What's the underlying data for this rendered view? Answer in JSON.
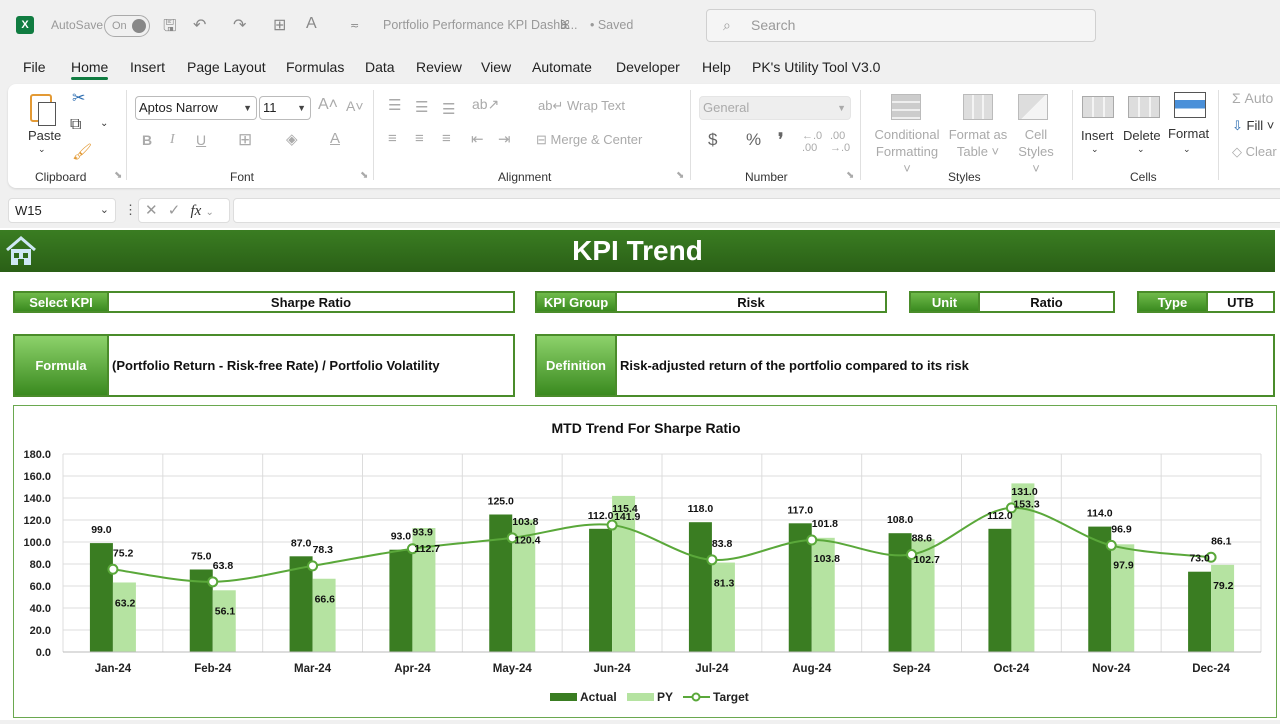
{
  "titlebar": {
    "app_icon": "excel-logo-icon",
    "app_letter": "X",
    "autosave_label": "AutoSave",
    "autosave_state": "On",
    "document_title": "Portfolio Performance KPI Dashb...",
    "saved_status": "• Saved",
    "search_placeholder": "Search"
  },
  "menu": {
    "items": [
      "File",
      "Home",
      "Insert",
      "Page Layout",
      "Formulas",
      "Data",
      "Review",
      "View",
      "Automate",
      "Developer",
      "Help",
      "PK's Utility Tool V3.0"
    ],
    "active": "Home"
  },
  "ribbon": {
    "clipboard": {
      "paste_label": "Paste",
      "group_label": "Clipboard"
    },
    "font": {
      "font_name": "Aptos Narrow",
      "font_size": "11",
      "bold": "B",
      "italic": "I",
      "underline": "U",
      "group_label": "Font"
    },
    "alignment": {
      "wrap_text": "Wrap Text",
      "merge_center": "Merge & Center",
      "group_label": "Alignment"
    },
    "number": {
      "format": "General",
      "currency": "$",
      "percent": "%",
      "comma": "❜",
      "group_label": "Number"
    },
    "styles": {
      "conditional_formatting": [
        "Conditional",
        "Formatting"
      ],
      "format_as_table": [
        "Format as",
        "Table"
      ],
      "cell_styles": [
        "Cell",
        "Styles"
      ],
      "group_label": "Styles"
    },
    "cells": {
      "insert": "Insert",
      "delete": "Delete",
      "format": "Format",
      "group_label": "Cells"
    },
    "editing": {
      "autosum": "Auto",
      "fill": "Fill",
      "clear": "Clear"
    }
  },
  "formula_bar": {
    "name_box": "W15",
    "fx": "fx",
    "formula": ""
  },
  "dashboard": {
    "title": "KPI Trend",
    "select_kpi": {
      "label": "Select KPI",
      "value": "Sharpe Ratio"
    },
    "kpi_group": {
      "label": "KPI Group",
      "value": "Risk"
    },
    "unit": {
      "label": "Unit",
      "value": "Ratio"
    },
    "type": {
      "label": "Type",
      "value": "UTB"
    },
    "formula": {
      "label": "Formula",
      "value": "(Portfolio Return - Risk-free Rate) / Portfolio Volatility"
    },
    "definition": {
      "label": "Definition",
      "value": "Risk-adjusted return of the portfolio compared to its risk"
    }
  },
  "colors": {
    "actual": "#3a7d22",
    "py": "#b5e3a1",
    "target": "#5aa83a",
    "banner": "#2f6b1a"
  },
  "chart_data": {
    "type": "bar",
    "title": "MTD Trend For Sharpe Ratio",
    "xlabel": "",
    "ylabel": "",
    "categories": [
      "Jan-24",
      "Feb-24",
      "Mar-24",
      "Apr-24",
      "May-24",
      "Jun-24",
      "Jul-24",
      "Aug-24",
      "Sep-24",
      "Oct-24",
      "Nov-24",
      "Dec-24"
    ],
    "series": [
      {
        "name": "Actual",
        "type": "bar",
        "values": [
          99.0,
          75.0,
          87.0,
          93.0,
          125.0,
          112.0,
          118.0,
          117.0,
          108.0,
          112.0,
          114.0,
          73.0
        ]
      },
      {
        "name": "PY",
        "type": "bar",
        "values": [
          63.2,
          56.1,
          66.6,
          112.7,
          120.4,
          141.9,
          81.3,
          103.8,
          102.7,
          153.3,
          97.9,
          79.2
        ]
      },
      {
        "name": "Target",
        "type": "line",
        "values": [
          75.2,
          63.8,
          78.3,
          93.9,
          103.8,
          115.4,
          83.8,
          101.8,
          88.6,
          131.0,
          96.9,
          86.1
        ]
      }
    ],
    "ylim": [
      0,
      180
    ],
    "yticks": [
      "0.0",
      "20.0",
      "40.0",
      "60.0",
      "80.0",
      "100.0",
      "120.0",
      "140.0",
      "160.0",
      "180.0"
    ],
    "grid": true,
    "legend": "bottom"
  }
}
